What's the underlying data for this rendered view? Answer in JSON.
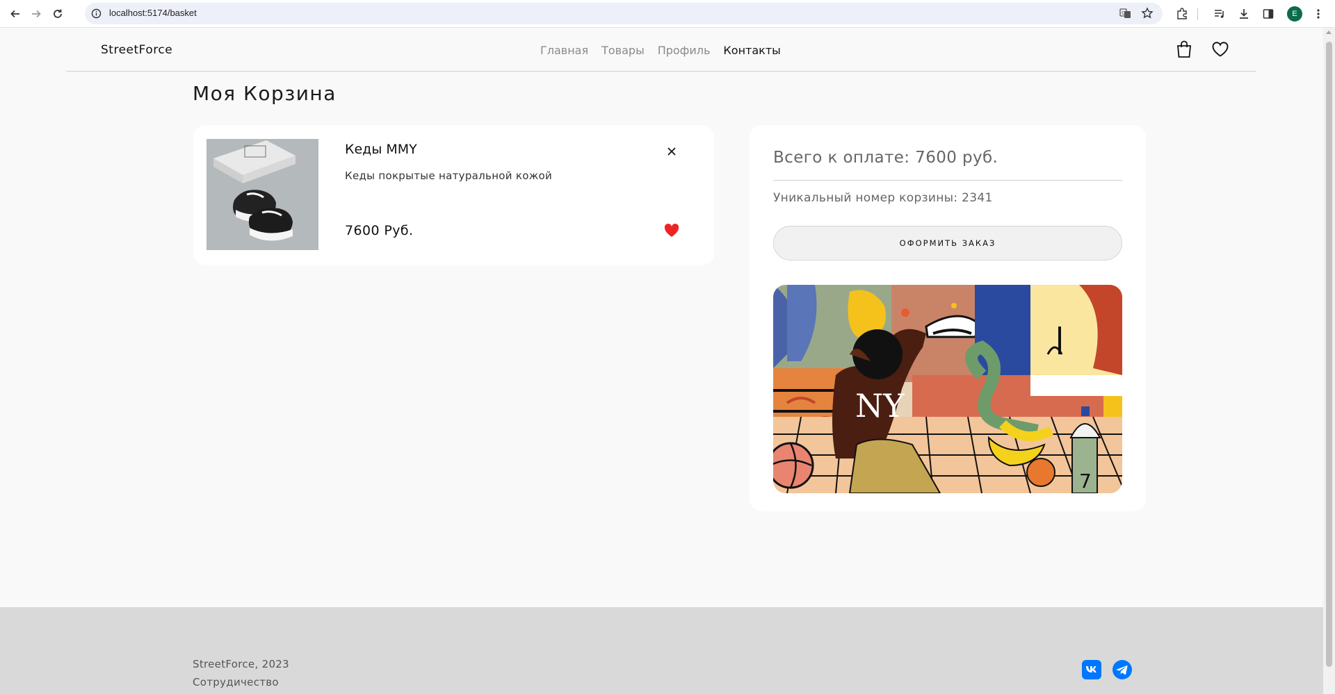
{
  "browser": {
    "url": "localhost:5174/basket",
    "profile_initial": "E"
  },
  "header": {
    "logo": "StreetForce",
    "nav": [
      {
        "label": "Главная",
        "active": false
      },
      {
        "label": "Товары",
        "active": false
      },
      {
        "label": "Профиль",
        "active": false
      },
      {
        "label": "Контакты",
        "active": true
      }
    ]
  },
  "page": {
    "title": "Моя Корзина"
  },
  "cart_item": {
    "name": "Кеды MMY",
    "description": "Кеды покрытые натуральной кожой",
    "price": "7600 Руб."
  },
  "summary": {
    "total": "Всего к оплате: 7600 руб.",
    "cart_number": "Уникальный номер корзины: 2341",
    "order_button": "ОФОРМИТЬ ЗАКАЗ"
  },
  "footer": {
    "copyright": "StreetForce, 2023",
    "link": "Сотрудичество"
  },
  "colors": {
    "favorite": "#ee2424",
    "social": "#0077ff"
  }
}
